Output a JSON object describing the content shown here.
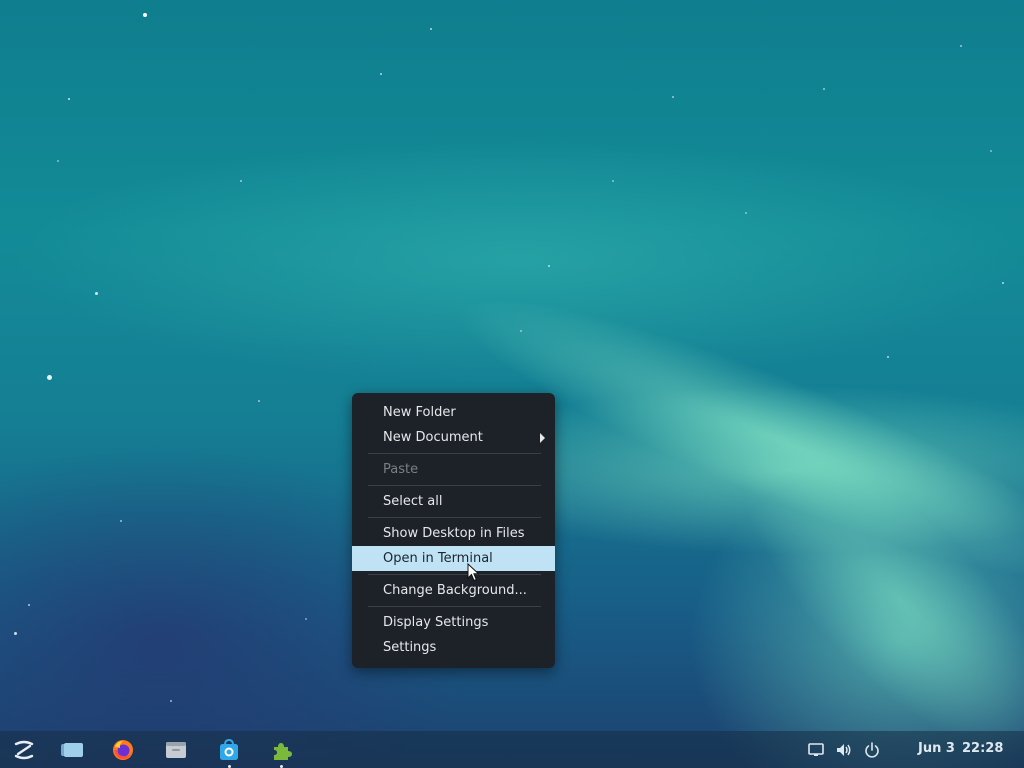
{
  "context_menu": {
    "items": [
      {
        "label": "New Folder"
      },
      {
        "label": "New Document",
        "has_submenu": true
      },
      {
        "label": "Paste",
        "disabled": true
      },
      {
        "label": "Select all"
      },
      {
        "label": "Show Desktop in Files"
      },
      {
        "label": "Open in Terminal",
        "highlighted": true
      },
      {
        "label": "Change Background..."
      },
      {
        "label": "Display Settings"
      },
      {
        "label": "Settings"
      }
    ]
  },
  "taskbar": {
    "launchers": [
      {
        "icon": "zorin-menu-icon"
      },
      {
        "icon": "workspaces-icon"
      },
      {
        "icon": "firefox-icon"
      },
      {
        "icon": "files-icon"
      },
      {
        "icon": "software-store-icon",
        "running": true
      },
      {
        "icon": "extensions-icon",
        "running": true
      }
    ],
    "tray": {
      "icons": [
        "display-icon",
        "volume-icon",
        "power-icon"
      ]
    },
    "clock": {
      "date": "Jun 3",
      "time": "22:28"
    }
  },
  "colors": {
    "menu_background": "#1d2128",
    "menu_highlight": "#bfe3f4",
    "menu_text": "#e6e8ea",
    "menu_disabled_text": "#7a7f86"
  }
}
